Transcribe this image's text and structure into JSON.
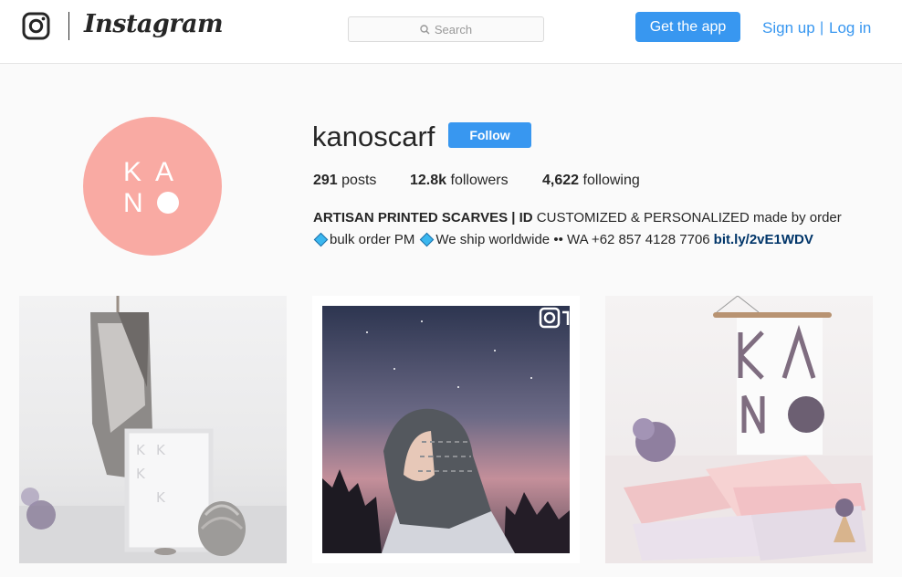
{
  "header": {
    "logo_icon": "instagram-camera-icon",
    "wordmark": "Instagram",
    "search_placeholder": "Search",
    "get_app": "Get the app",
    "sign_up": "Sign up",
    "divider": "|",
    "log_in": "Log in"
  },
  "profile": {
    "avatar_letters": [
      "K",
      "A",
      "N"
    ],
    "username": "kanoscarf",
    "follow": "Follow",
    "stats": [
      {
        "value": "291",
        "label": "posts"
      },
      {
        "value": "12.8k",
        "label": "followers"
      },
      {
        "value": "4,622",
        "label": "following"
      }
    ],
    "bio_line1_bold": "ARTISAN PRINTED SCARVES | ID",
    "bio_line1_rest": "CUSTOMIZED & PERSONALIZED made by order",
    "bio_line2_a": "bulk order PM",
    "bio_line2_b": "We ship worldwide •• WA +62 857 4128 7706",
    "bio_link": "bit.ly/2vE1WDV"
  },
  "posts": [
    {
      "description": "scarf-and-frame-photo"
    },
    {
      "description": "hijab-starry-sky-photo",
      "badge_icon": "multi-photo-icon"
    },
    {
      "description": "kano-banner-scarves-photo"
    }
  ],
  "colors": {
    "accent": "#3897f0",
    "avatar_bg": "#f9aaa3",
    "diamond": "#3ab7ef",
    "link": "#003569"
  }
}
